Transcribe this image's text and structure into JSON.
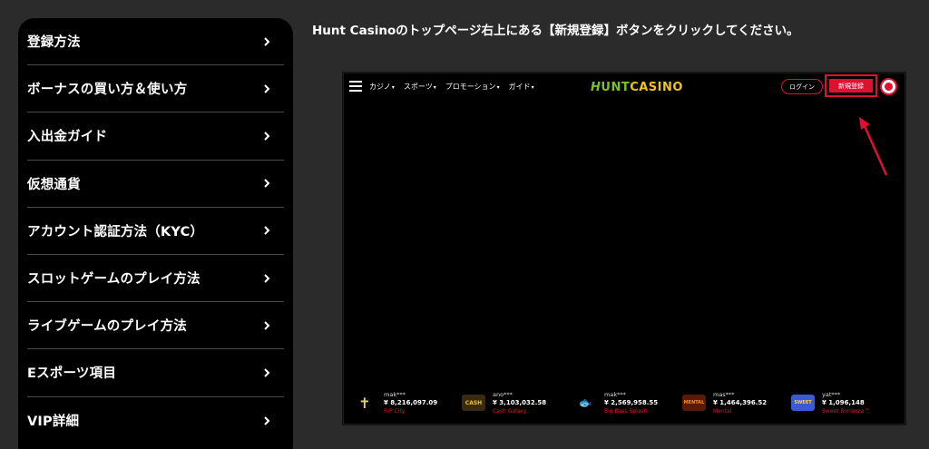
{
  "sidebar": {
    "items": [
      {
        "label": "登録方法"
      },
      {
        "label": "ボーナスの買い方＆使い方"
      },
      {
        "label": "入出金ガイド"
      },
      {
        "label": "仮想通貨"
      },
      {
        "label": "アカウント認証方法（KYC）"
      },
      {
        "label": "スロットゲームのプレイ方法"
      },
      {
        "label": "ライブゲームのプレイ方法"
      },
      {
        "label": "Eスポーツ項目"
      },
      {
        "label": "VIP詳細"
      }
    ]
  },
  "instruction": "Hunt Casinoのトップページ右上にある【新規登録】ボタンをクリックしてください。",
  "screenshot": {
    "nav": [
      {
        "label": "カジノ"
      },
      {
        "label": "スポーツ"
      },
      {
        "label": "プロモーション"
      },
      {
        "label": "ガイド"
      }
    ],
    "logo": {
      "h": "H",
      "hunt": "UNT",
      "casino": "CASINO"
    },
    "login_label": "ログイン",
    "signup_label": "新規登録",
    "winners": [
      {
        "user": "mak***",
        "amount": "¥ 8,216,097.09",
        "game": "RIP City",
        "thumb": "✝"
      },
      {
        "user": "ano***",
        "amount": "¥ 3,103,032.58",
        "game": "Cash Galaxy",
        "thumb": "CASH"
      },
      {
        "user": "mak***",
        "amount": "¥ 2,569,958.55",
        "game": "Big Bass Splash",
        "thumb": "🐟"
      },
      {
        "user": "mas***",
        "amount": "¥ 1,464,396.52",
        "game": "Mental",
        "thumb": "MENTAL"
      },
      {
        "user": "yat***",
        "amount": "¥ 1,096,148",
        "game": "Sweet Bonanza™",
        "thumb": "SWEET"
      }
    ]
  },
  "colors": {
    "accent": "#e01030",
    "logo_green": "#7cc41d",
    "logo_yellow": "#f2c318",
    "page_bg": "#2b2b2b"
  }
}
